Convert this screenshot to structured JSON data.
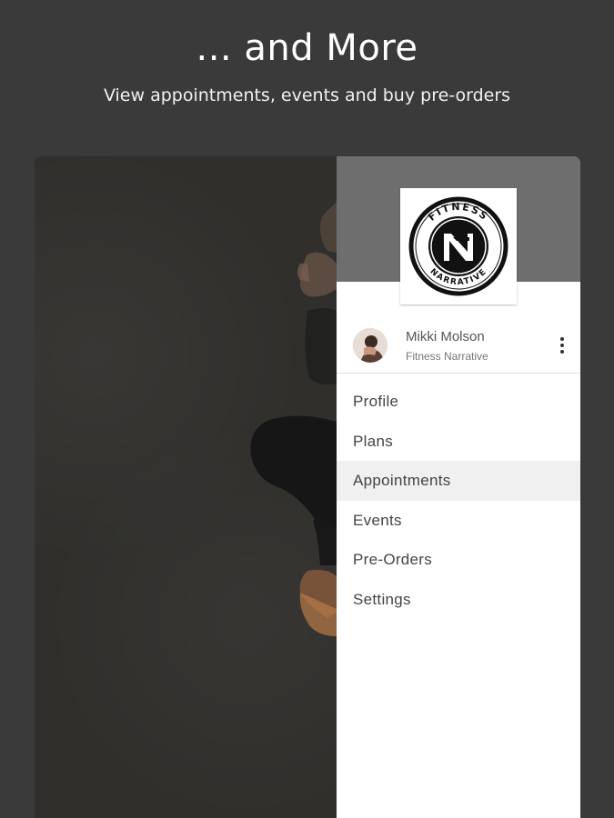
{
  "header": {
    "title": "... and More",
    "subtitle": "View appointments, events and buy pre-orders"
  },
  "drawer": {
    "logo": {
      "text_top": "FITNESS",
      "text_bottom": "NARRATIVE"
    },
    "user": {
      "name": "Mikki Molson",
      "organization": "Fitness Narrative"
    },
    "menu": [
      {
        "label": "Profile",
        "active": false
      },
      {
        "label": "Plans",
        "active": false
      },
      {
        "label": "Appointments",
        "active": true
      },
      {
        "label": "Events",
        "active": false
      },
      {
        "label": "Pre-Orders",
        "active": false
      },
      {
        "label": "Settings",
        "active": false
      }
    ]
  },
  "colors": {
    "page_background": "#3a3a3a",
    "drawer_header": "#6e6e6e",
    "active_item": "#f0f0f0"
  }
}
